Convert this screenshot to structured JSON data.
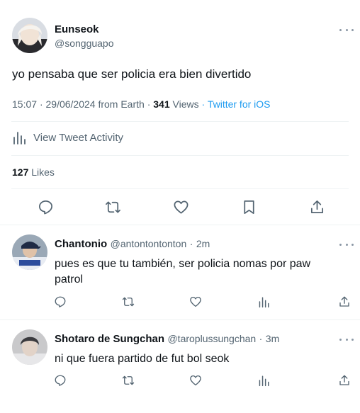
{
  "main_tweet": {
    "author_name": "Eunseok",
    "author_handle": "@songguapo",
    "text": "yo pensaba que ser policia era bien divertido",
    "time": "15:07",
    "date": "29/06/2024 from Earth",
    "views_count": "341",
    "views_label": "Views",
    "source": "Twitter for iOS",
    "activity_label": "View Tweet Activity",
    "likes_count": "127",
    "likes_label": "Likes"
  },
  "replies": [
    {
      "author_name": "Chantonio",
      "author_handle": "@antontontonton",
      "time": "2m",
      "text": "pues es que tu también, ser policia nomas por paw patrol"
    },
    {
      "author_name": "Shotaro de Sungchan",
      "author_handle": "@taroplussungchan",
      "time": "3m",
      "text": "ni que fuera partido de fut bol seok"
    }
  ],
  "separator": "·",
  "colors": {
    "accent": "#1d9bf0",
    "text": "#0f1419",
    "muted": "#536471",
    "divider": "#eff3f4"
  },
  "icons": [
    "more-icon",
    "analytics-icon",
    "reply-icon",
    "retweet-icon",
    "like-icon",
    "bookmark-icon",
    "share-icon"
  ]
}
